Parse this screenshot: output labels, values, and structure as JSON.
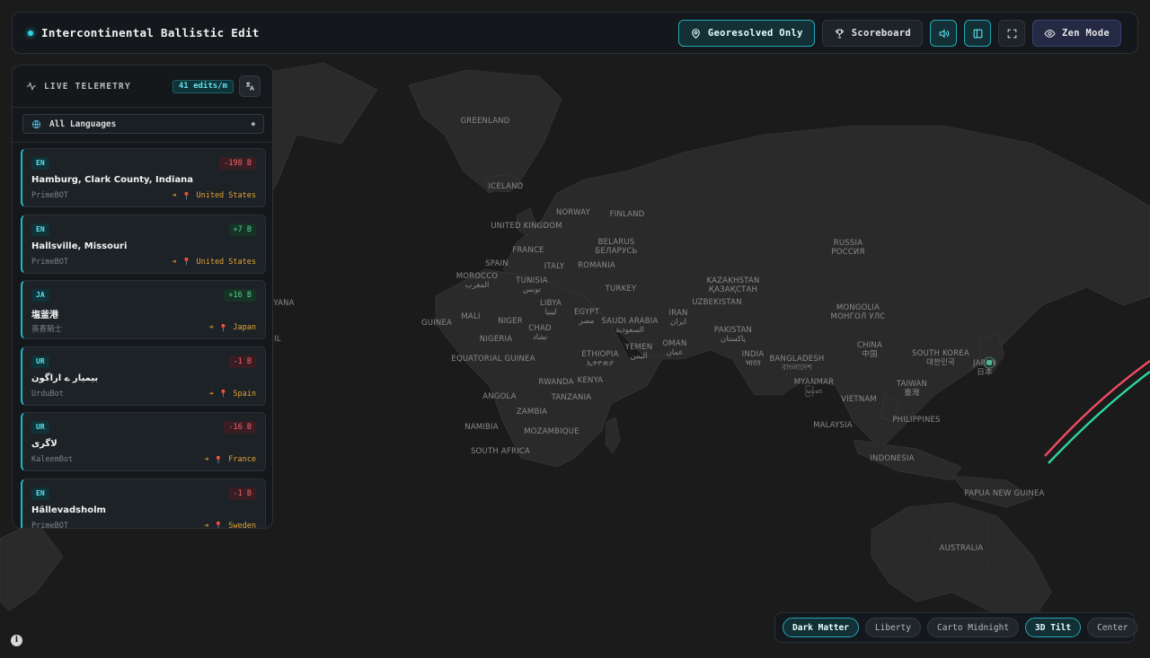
{
  "header": {
    "title": "Intercontinental Ballistic Edit",
    "buttons": {
      "georesolved": "Georesolved Only",
      "scoreboard": "Scoreboard",
      "zen": "Zen Mode"
    }
  },
  "sidebar": {
    "title": "LIVE TELEMETRY",
    "rate": "41 edits/m",
    "language_filter": "All Languages",
    "feed": [
      {
        "lang": "EN",
        "delta": "-198 B",
        "sign": "neg",
        "title": "Hamburg, Clark County, Indiana",
        "editor": "PrimeBOT",
        "country": "United States"
      },
      {
        "lang": "EN",
        "delta": "+7 B",
        "sign": "pos",
        "title": "Hallsville, Missouri",
        "editor": "PrimeBOT",
        "country": "United States"
      },
      {
        "lang": "JA",
        "delta": "+16 B",
        "sign": "pos",
        "title": "塩釜港",
        "editor": "喪喜騎士",
        "country": "Japan"
      },
      {
        "lang": "UR",
        "delta": "-1 B",
        "sign": "neg",
        "title": "بیمیار ے اراگون",
        "editor": "UrduBot",
        "country": "Spain"
      },
      {
        "lang": "UR",
        "delta": "-16 B",
        "sign": "neg",
        "title": "لاگری",
        "editor": "KaleemBot",
        "country": "France"
      },
      {
        "lang": "EN",
        "delta": "-1 B",
        "sign": "neg",
        "title": "Hällevadsholm",
        "editor": "PrimeBOT",
        "country": "Sweden"
      }
    ]
  },
  "map_labels": {
    "greenland": "GREENLAND",
    "iceland": "ICELAND",
    "norway": "NORWAY",
    "finland": "FINLAND",
    "uk": "UNITED KINGDOM",
    "belarus": "BELARUS\nБЕЛАРУСЬ",
    "russia": "RUSSIA\nРОССИЯ",
    "france": "FRANCE",
    "spain": "SPAIN",
    "italy": "ITALY",
    "romania": "ROMANIA",
    "kazakhstan": "KAZAKHSTAN\nҚАЗАҚСТАН",
    "morocco": "MOROCCO\nالمغرب",
    "tunisia": "TUNISIA\nتونس",
    "turkey": "TURKEY",
    "uzbekistan": "UZBEKISTAN",
    "mongolia": "MONGOLIA\nМОНГОЛ УЛС",
    "libya": "LIBYA\nليبيا",
    "egypt": "EGYPT\nمصر",
    "iran": "IRAN\nايران",
    "mali": "MALI",
    "niger": "NIGER",
    "chad": "CHAD\nتشاد",
    "saudi": "SAUDI ARABIA\nالسعودية",
    "pakistan": "PAKISTAN\nپاکستان",
    "china": "CHINA\n中国",
    "skorea": "SOUTH KOREA\n대한민국",
    "japan": "JAPAN\n日本",
    "guinea": "GUINEA",
    "nigeria": "NIGERIA",
    "oman": "OMAN\nعمان",
    "yemen": "YEMEN\nاليمن",
    "ethiopia": "ETHIOPIA\nኢትዮጵያ",
    "india": "INDIA\nभारत",
    "bangladesh": "BANGLADESH\nবাংলাদেশ",
    "myanmar": "MYANMAR\nမြန်မာ",
    "taiwan": "TAIWAN\n臺灣",
    "eqguinea": "EQUATORIAL GUINEA",
    "kenya": "KENYA",
    "rwanda": "RWANDA",
    "tanzania": "TANZANIA",
    "vietnam": "VIETNAM",
    "philippines": "PHILIPPINES",
    "angola": "ANGOLA",
    "zambia": "ZAMBIA",
    "malaysia": "MALAYSIA",
    "namibia": "NAMIBIA",
    "mozambique": "MOZAMBIQUE",
    "indonesia": "INDONESIA",
    "safrica": "SOUTH AFRICA",
    "png": "PAPUA NEW GUINEA",
    "australia": "AUSTRALIA",
    "lyana": "YANA",
    "lil": "IL"
  },
  "stylebar": {
    "dark_matter": "Dark Matter",
    "liberty": "Liberty",
    "carto_midnight": "Carto Midnight",
    "tilt": "3D Tilt",
    "center": "Center"
  },
  "colors": {
    "accent": "#2dd4e0",
    "neg": "#f0666f",
    "pos": "#4fd68b",
    "geo": "#e3a436"
  }
}
